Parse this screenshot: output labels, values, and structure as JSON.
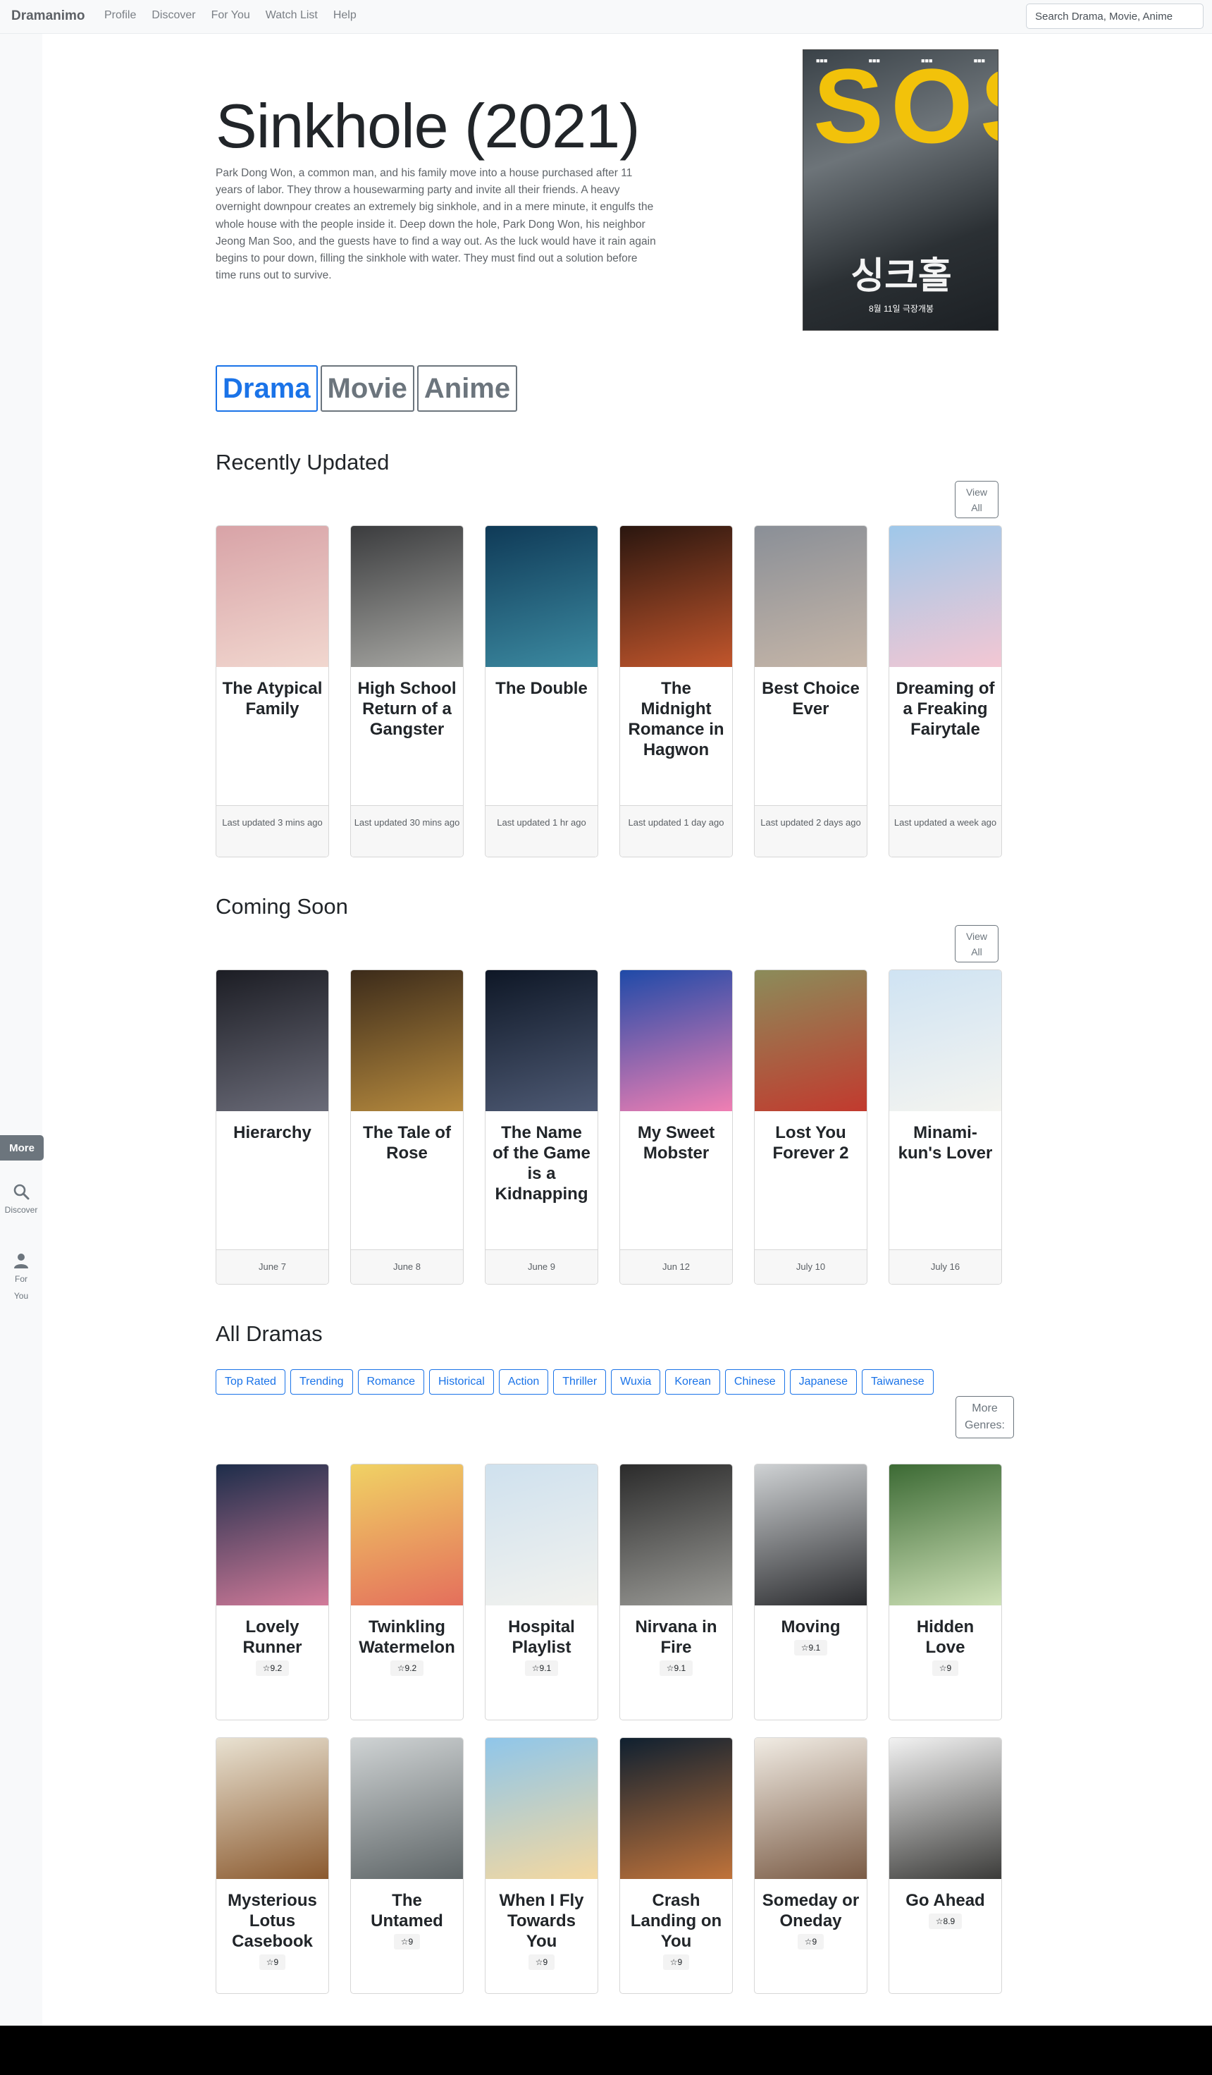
{
  "navbar": {
    "brand": "Dramanimo",
    "links": [
      "Profile",
      "Discover",
      "For You",
      "Watch List",
      "Help"
    ],
    "search_placeholder": "Search Drama, Movie, Anime"
  },
  "sidebar": {
    "more": "More",
    "discover": "Discover",
    "for_you_1": "For",
    "for_you_2": "You"
  },
  "hero": {
    "title": "Sinkhole (2021)",
    "description": "Park Dong Won, a common man, and his family move into a house purchased after 11 years of labor. They throw a housewarming party and invite all their friends. A heavy overnight downpour creates an extremely big sinkhole, and in a mere minute, it engulfs the whole house with the people inside it. Deep down the hole, Park Dong Won, his neighbor Jeong Man Soo, and the guests have to find a way out. As the luck would have it rain again begins to pour down, filling the sinkhole with water. They must find out a solution before time runs out to survive.",
    "poster_big_text": "SOS",
    "poster_korean": "싱크홀",
    "poster_date": "8월 11일 극장개봉"
  },
  "type_tabs": [
    "Drama",
    "Movie",
    "Anime"
  ],
  "recently_updated": {
    "heading": "Recently Updated",
    "view_all_1": "View",
    "view_all_2": "All",
    "items": [
      {
        "title": "The Atypical Family",
        "foot": "Last updated 3 mins ago",
        "c1": "#d8a3a7",
        "c2": "#f1d7cf"
      },
      {
        "title": "High School Return of a Gangster",
        "foot": "Last updated 30 mins ago",
        "c1": "#3b3c3e",
        "c2": "#a8a8a4"
      },
      {
        "title": "The Double",
        "foot": "Last updated 1 hr ago",
        "c1": "#0f3a57",
        "c2": "#3c8aa1"
      },
      {
        "title": "The Midnight Romance in Hagwon",
        "foot": "Last updated 1 day ago",
        "c1": "#2a160f",
        "c2": "#c2562c"
      },
      {
        "title": "Best Choice Ever",
        "foot": "Last updated 2 days ago",
        "c1": "#8a8f97",
        "c2": "#c6b6a8"
      },
      {
        "title": "Dreaming of a Freaking Fairytale",
        "foot": "Last updated a week ago",
        "c1": "#9fc8ea",
        "c2": "#f3c7d3"
      }
    ]
  },
  "coming_soon": {
    "heading": "Coming Soon",
    "view_all_1": "View",
    "view_all_2": "All",
    "items": [
      {
        "title": "Hierarchy",
        "foot": "June 7",
        "c1": "#1c1d24",
        "c2": "#6a6b78"
      },
      {
        "title": "The Tale of Rose",
        "foot": "June 8",
        "c1": "#3c2b1a",
        "c2": "#b68a3e"
      },
      {
        "title": "The Name of the Game is a Kidnapping",
        "foot": "June 9",
        "c1": "#0e1726",
        "c2": "#4e5a74"
      },
      {
        "title": "My Sweet Mobster",
        "foot": "Jun 12",
        "c1": "#1f4aa8",
        "c2": "#f07fb3"
      },
      {
        "title": "Lost You Forever 2",
        "foot": "July 10",
        "c1": "#8b8c5a",
        "c2": "#c23a2e"
      },
      {
        "title": "Minami-kun's Lover",
        "foot": "July 16",
        "c1": "#cfe3f3",
        "c2": "#f4f4f0"
      }
    ]
  },
  "all_dramas": {
    "heading": "All Dramas",
    "genres": [
      "Top Rated",
      "Trending",
      "Romance",
      "Historical",
      "Action",
      "Thriller",
      "Wuxia",
      "Korean",
      "Chinese",
      "Japanese",
      "Taiwanese"
    ],
    "more_genres_1": "More",
    "more_genres_2": "Genres:",
    "row1": [
      {
        "title": "Lovely Runner",
        "rating": "☆9.2",
        "c1": "#1d2d4a",
        "c2": "#d27b9a"
      },
      {
        "title": "Twinkling Watermelon",
        "rating": "☆9.2",
        "c1": "#f0d264",
        "c2": "#e46f5c"
      },
      {
        "title": "Hospital Playlist",
        "rating": "☆9.1",
        "c1": "#cfe1ee",
        "c2": "#f2f2ee"
      },
      {
        "title": "Nirvana in Fire",
        "rating": "☆9.1",
        "c1": "#2b2b2b",
        "c2": "#9a9a96"
      },
      {
        "title": "Moving",
        "rating": "☆9.1",
        "c1": "#cfd2d4",
        "c2": "#2a2b2e"
      },
      {
        "title": "Hidden Love",
        "rating": "☆9",
        "c1": "#3c6a34",
        "c2": "#cfe2b8"
      }
    ],
    "row2": [
      {
        "title": "Mysterious Lotus Casebook",
        "rating": "☆9",
        "c1": "#e9e2d2",
        "c2": "#8b5a2f"
      },
      {
        "title": "The Untamed",
        "rating": "☆9",
        "c1": "#cfd3d4",
        "c2": "#5e6567"
      },
      {
        "title": "When I Fly Towards You",
        "rating": "☆9",
        "c1": "#8fc6ea",
        "c2": "#f4d8a0"
      },
      {
        "title": "Crash Landing on You",
        "rating": "☆9",
        "c1": "#0f2030",
        "c2": "#c0733a"
      },
      {
        "title": "Someday or Oneday",
        "rating": "☆9",
        "c1": "#f1ece4",
        "c2": "#7a5b45"
      },
      {
        "title": "Go Ahead",
        "rating": "☆8.9",
        "c1": "#f2f2f2",
        "c2": "#3c3c3a"
      }
    ]
  }
}
